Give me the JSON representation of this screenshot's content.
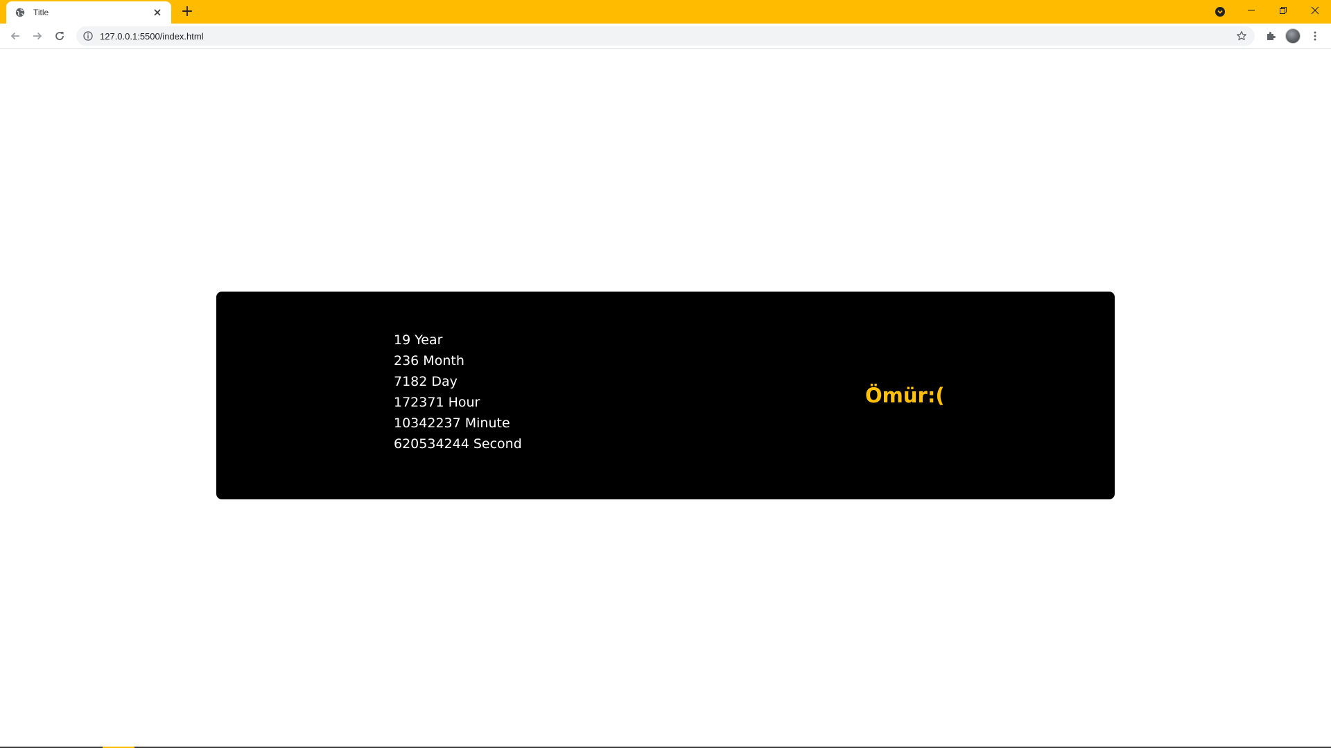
{
  "browser": {
    "tab_title": "Title",
    "new_tab_symbol": "+",
    "url": "127.0.0.1:5500/index.html",
    "accent_color": "#ffbb00"
  },
  "content": {
    "stats": [
      "19 Year",
      "236 Month",
      "7182 Day",
      "172371 Hour",
      "10342237 Minute",
      "620534244 Second"
    ],
    "heading": "Ömür:(",
    "heading_color": "#ffc107",
    "card_color": "#000000"
  }
}
